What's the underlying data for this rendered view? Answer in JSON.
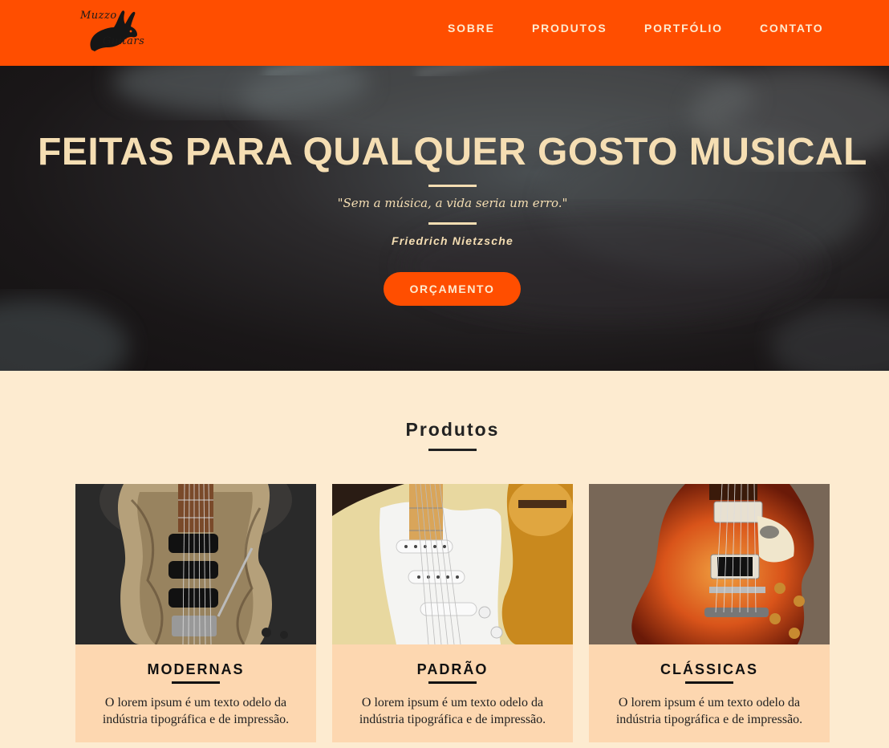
{
  "brand": {
    "logo_line1": "Muzzo",
    "logo_line2": "Guitars"
  },
  "nav": {
    "items": [
      "SOBRE",
      "PRODUTOS",
      "PORTFÓLIO",
      "CONTATO"
    ]
  },
  "hero": {
    "title": "FEITAS PARA QUALQUER GOSTO MUSICAL",
    "quote": "\"Sem a música, a vida seria um erro.\"",
    "author": "Friedrich Nietzsche",
    "button_label": "ORÇAMENTO"
  },
  "products": {
    "title": "Produtos",
    "cards": [
      {
        "title": "MODERNAS",
        "description": "O lorem ipsum é um texto odelo da indústria tipográfica e de impressão."
      },
      {
        "title": "PADRÃO",
        "description": "O lorem ipsum é um texto odelo da indústria tipográfica e de impressão."
      },
      {
        "title": "CLÁSSICAS",
        "description": "O lorem ipsum é um texto odelo da indústria tipográfica e de impressão."
      }
    ]
  },
  "colors": {
    "accent": "#ff4e00",
    "cream": "#fdebd0",
    "hero_text": "#f5deb3",
    "card_bg": "#fdd7b0"
  }
}
